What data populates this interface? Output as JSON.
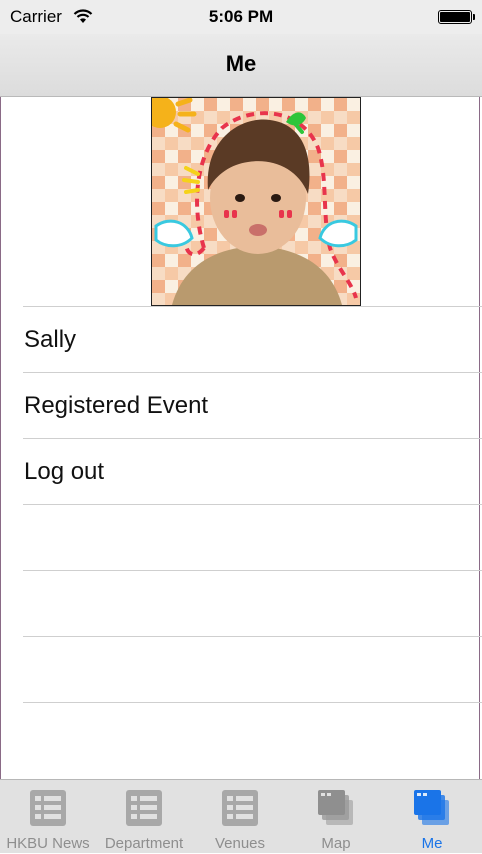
{
  "status_bar": {
    "carrier": "Carrier",
    "time": "5:06 PM"
  },
  "navbar": {
    "title": "Me"
  },
  "profile": {
    "avatar_icon": "profile-photo"
  },
  "menu": {
    "items": [
      {
        "label": "Sally"
      },
      {
        "label": "Registered Event"
      },
      {
        "label": "Log out"
      },
      {
        "label": ""
      },
      {
        "label": ""
      },
      {
        "label": ""
      },
      {
        "label": ""
      }
    ]
  },
  "tabbar": {
    "tabs": [
      {
        "label": "HKBU News",
        "icon": "list-icon",
        "active": false
      },
      {
        "label": "Department",
        "icon": "list-icon",
        "active": false
      },
      {
        "label": "Venues",
        "icon": "list-icon",
        "active": false
      },
      {
        "label": "Map",
        "icon": "windows-icon",
        "active": false
      },
      {
        "label": "Me",
        "icon": "windows-icon",
        "active": true
      }
    ],
    "active_color": "#1a74e8",
    "inactive_color": "#8e8e8e"
  }
}
